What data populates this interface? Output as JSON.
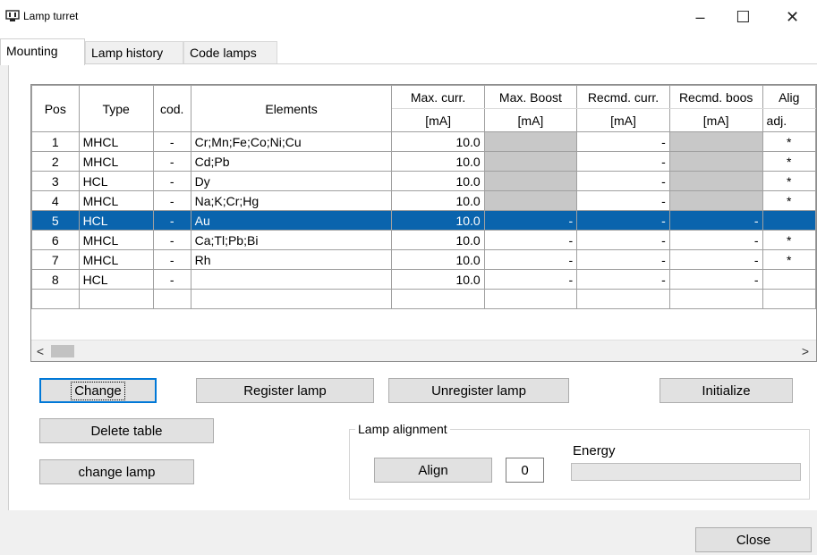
{
  "window": {
    "title": "Lamp turret",
    "minimize": "–",
    "maximize": "☐",
    "close": "✕"
  },
  "tabs": [
    {
      "label": "Mounting"
    },
    {
      "label": "Lamp history"
    },
    {
      "label": "Code lamps"
    }
  ],
  "grid": {
    "headers": {
      "pos": "Pos",
      "type": "Type",
      "cod": "cod.",
      "elements": "Elements",
      "maxcurr": "Max. curr.",
      "maxcurr_unit": "[mA]",
      "maxboost": "Max. Boost",
      "maxboost_unit": "[mA]",
      "recmdcurr": "Recmd. curr.",
      "recmdcurr_unit": "[mA]",
      "recmdboost": "Recmd. boos",
      "recmdboost_unit": "[mA]",
      "align": "Alig",
      "align_unit": "adj."
    },
    "rows": [
      {
        "pos": "1",
        "type": "MHCL",
        "cod": "-",
        "elements": "Cr;Mn;Fe;Co;Ni;Cu",
        "maxcurr": "10.0",
        "maxboost": "",
        "recmdcurr": "-",
        "recmdboost": "",
        "adj": "*"
      },
      {
        "pos": "2",
        "type": "MHCL",
        "cod": "-",
        "elements": "Cd;Pb",
        "maxcurr": "10.0",
        "maxboost": "",
        "recmdcurr": "-",
        "recmdboost": "",
        "adj": "*"
      },
      {
        "pos": "3",
        "type": "HCL",
        "cod": "-",
        "elements": "Dy",
        "maxcurr": "10.0",
        "maxboost": "",
        "recmdcurr": "-",
        "recmdboost": "",
        "adj": "*"
      },
      {
        "pos": "4",
        "type": "MHCL",
        "cod": "-",
        "elements": "Na;K;Cr;Hg",
        "maxcurr": "10.0",
        "maxboost": "",
        "recmdcurr": "-",
        "recmdboost": "",
        "adj": "*"
      },
      {
        "pos": "5",
        "type": "HCL",
        "cod": "-",
        "elements": "Au",
        "maxcurr": "10.0",
        "maxboost": "-",
        "recmdcurr": "-",
        "recmdboost": "-",
        "adj": ""
      },
      {
        "pos": "6",
        "type": "MHCL",
        "cod": "-",
        "elements": "Ca;Tl;Pb;Bi",
        "maxcurr": "10.0",
        "maxboost": "-",
        "recmdcurr": "-",
        "recmdboost": "-",
        "adj": "*"
      },
      {
        "pos": "7",
        "type": "MHCL",
        "cod": "-",
        "elements": "Rh",
        "maxcurr": "10.0",
        "maxboost": "-",
        "recmdcurr": "-",
        "recmdboost": "-",
        "adj": "*"
      },
      {
        "pos": "8",
        "type": "HCL",
        "cod": "-",
        "elements": "",
        "maxcurr": "10.0",
        "maxboost": "-",
        "recmdcurr": "-",
        "recmdboost": "-",
        "adj": ""
      }
    ],
    "scroll_left": "<",
    "scroll_right": ">"
  },
  "buttons": {
    "change": "Change",
    "register": "Register lamp",
    "unregister": "Unregister lamp",
    "initialize": "Initialize",
    "delete_table": "Delete table",
    "change_lamp": "change lamp",
    "close": "Close"
  },
  "alignment": {
    "group_label": "Lamp alignment",
    "align_button": "Align",
    "counter": "0",
    "energy_label": "Energy",
    "energy_level": 0
  }
}
